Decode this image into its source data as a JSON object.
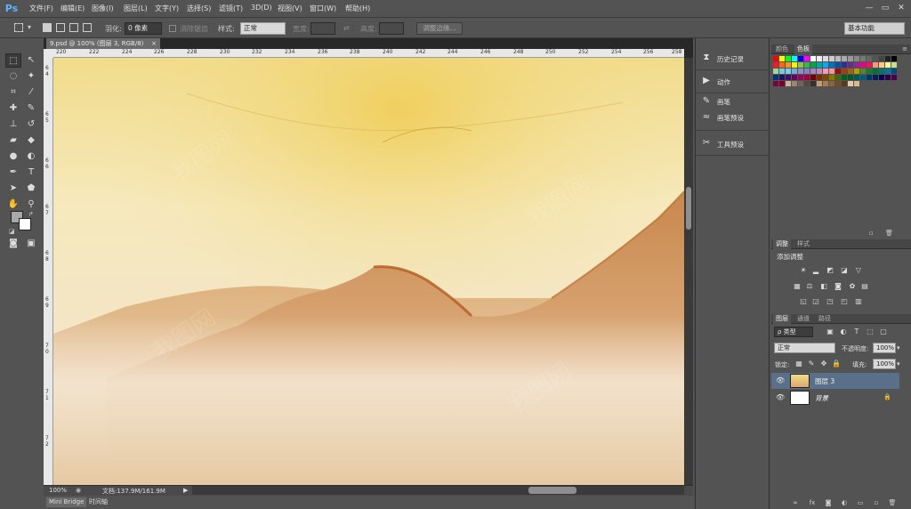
{
  "app": {
    "logo": "Ps"
  },
  "menu": [
    "文件(F)",
    "编辑(E)",
    "图像(I)",
    "图层(L)",
    "文字(Y)",
    "选择(S)",
    "滤镜(T)",
    "3D(D)",
    "视图(V)",
    "窗口(W)",
    "帮助(H)"
  ],
  "window_controls": {
    "minimize": "—",
    "restore": "▭",
    "close": "✕"
  },
  "options": {
    "feather_label": "羽化:",
    "feather_value": "0 像素",
    "antialias_label": "消除锯齿",
    "style_label": "样式:",
    "style_value": "正常",
    "width_label": "宽度:",
    "swap": "⇄",
    "height_label": "高度:",
    "refine_edge": "调整边缘...",
    "workspace": "基本功能"
  },
  "document": {
    "tab_title": "9.psd @ 100% (图层 3, RGB/8)",
    "tab_close": "×",
    "ruler_h": [
      "220",
      "222",
      "224",
      "226",
      "228",
      "230",
      "232",
      "234",
      "236",
      "238",
      "240",
      "242",
      "244",
      "246",
      "248",
      "250",
      "252",
      "254",
      "256",
      "258"
    ],
    "ruler_v": [
      "6 4",
      "6 5",
      "6 6",
      "6 7",
      "6 8",
      "6 9",
      "7 0",
      "7 1",
      "7 2"
    ],
    "zoom": "100%",
    "doc_info": "文档:137.9M/161.9M",
    "watermark": "我图网"
  },
  "bottom_tabs": [
    "Mini Bridge",
    "时间轴"
  ],
  "mid_panel": [
    {
      "icon": "history-icon",
      "glyph": "⧗",
      "label": "历史记录"
    },
    {
      "icon": "play-icon",
      "glyph": "▶",
      "label": "动作"
    },
    {
      "icon": "brush-icon",
      "glyph": "✎",
      "label": "画笔"
    },
    {
      "icon": "brush-preset-icon",
      "glyph": "≈",
      "label": "画笔预设"
    },
    {
      "icon": "tool-preset-icon",
      "glyph": "✂",
      "label": "工具预设"
    }
  ],
  "swatch_panel": {
    "tabs": [
      "颜色",
      "色板"
    ],
    "active": 1
  },
  "adjust_panel": {
    "tabs": [
      "调整",
      "样式"
    ],
    "title": "添加调整"
  },
  "layers_panel": {
    "tabs": [
      "图层",
      "通道",
      "路径"
    ],
    "filter_type": "ρ 类型",
    "blend_mode": "正常",
    "opacity_label": "不透明度:",
    "opacity_value": "100%",
    "lock_label": "锁定:",
    "fill_label": "填充:",
    "fill_value": "100%",
    "layers": [
      {
        "name": "图层 3",
        "selected": true
      },
      {
        "name": "背景",
        "selected": false,
        "locked": true
      }
    ]
  },
  "colors": {
    "ui_bg": "#535353",
    "doc_bg": "#282828",
    "accent": "#5eb3ff",
    "selected_layer": "#5a6f8a"
  }
}
